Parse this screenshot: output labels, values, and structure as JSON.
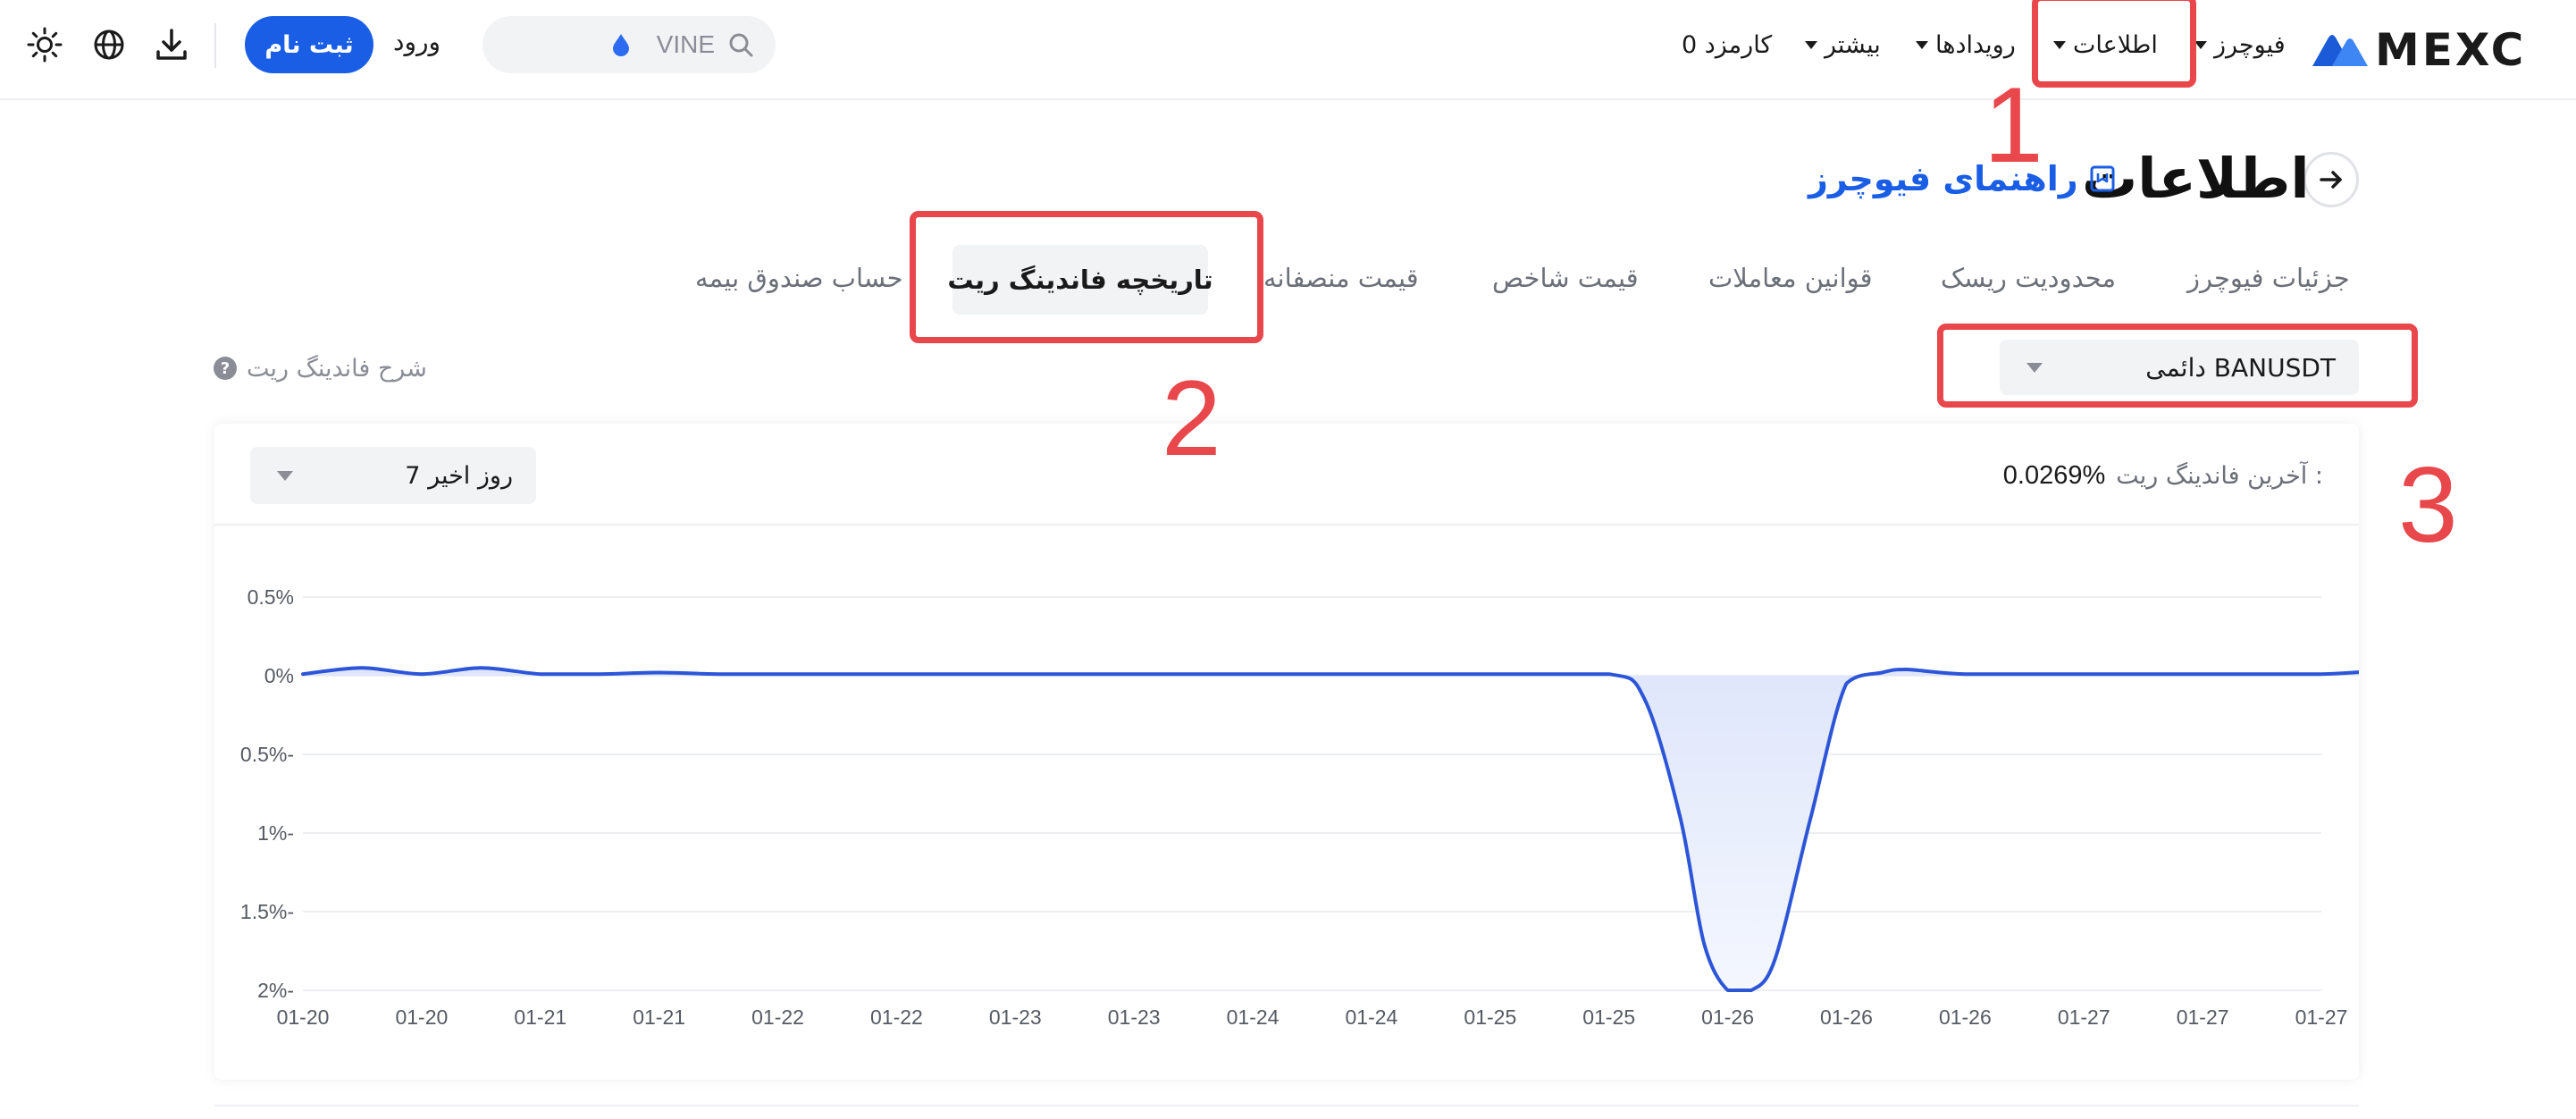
{
  "nav": {
    "brand": "MEXC",
    "items": [
      {
        "label": "فیوچرز",
        "has_caret": true
      },
      {
        "label": "اطلاعات",
        "has_caret": true
      },
      {
        "label": "رویدادها",
        "has_caret": true
      },
      {
        "label": "بیشتر",
        "has_caret": true
      },
      {
        "label": "0 کارمزد",
        "has_caret": false
      }
    ],
    "search_value": "VINE",
    "login_label": "ورود",
    "register_label": "ثبت نام",
    "icons": [
      "download-icon",
      "globe-icon",
      "sun-icon",
      "search-icon",
      "droplet-icon"
    ]
  },
  "page": {
    "title": "اطلاعات",
    "guide_link": "راهنمای فیوچرز",
    "tabs": [
      "جزئیات فیوچرز",
      "محدودیت ریسک",
      "قوانین معاملات",
      "قیمت شاخص",
      "قیمت منصفانه",
      "تاریخچه فاندینگ ریت",
      "حساب صندوق بیمه"
    ],
    "active_tab": "تاریخچه فاندینگ ریت",
    "contract_select": "دائمی BANUSDT",
    "explain_link": "شرح فاندینگ ریت"
  },
  "card": {
    "latest_label": "آخرین فاندینگ ریت :",
    "latest_value": "0.0269%",
    "range_select": "7 روز اخیر"
  },
  "annotations": [
    "1",
    "2",
    "3"
  ],
  "colors": {
    "accent": "#1a5ee6",
    "line": "#2d55d8",
    "annotation": "#e8474b"
  },
  "chart_data": {
    "type": "area",
    "title": "",
    "xlabel": "",
    "ylabel": "",
    "ylim": [
      -2.0,
      0.5
    ],
    "y_ticks": [
      0.5,
      0,
      -0.5,
      -1,
      -1.5,
      -2
    ],
    "y_tick_labels": [
      "0.5%",
      "0%",
      "0.5%-",
      "1%-",
      "1.5%-",
      "2%-"
    ],
    "x_tick_labels": [
      "01-20",
      "01-20",
      "01-21",
      "01-21",
      "01-22",
      "01-22",
      "01-23",
      "01-23",
      "01-24",
      "01-24",
      "01-25",
      "01-25",
      "01-26",
      "01-26",
      "01-26",
      "01-27",
      "01-27",
      "01-27"
    ],
    "grid": true,
    "legend": "none",
    "series": [
      {
        "x": [
          0,
          0.5,
          1,
          1.5,
          2,
          2.5,
          3,
          3.5,
          4,
          5,
          6,
          7,
          8,
          9,
          10,
          11,
          11.3,
          11.6,
          11.8,
          12,
          12.2,
          12.4,
          12.7,
          13,
          13.3,
          13.5,
          14,
          15,
          16,
          17,
          17.5,
          18
        ],
        "values": [
          0.01,
          0.05,
          0.01,
          0.05,
          0.01,
          0.01,
          0.02,
          0.01,
          0.01,
          0.01,
          0.01,
          0.01,
          0.01,
          0.01,
          0.01,
          0.01,
          -0.15,
          -0.9,
          -1.7,
          -2.0,
          -2.0,
          -1.8,
          -0.9,
          -0.05,
          0.02,
          0.04,
          0.01,
          0.01,
          0.01,
          0.01,
          0.03,
          0.027
        ]
      }
    ]
  }
}
